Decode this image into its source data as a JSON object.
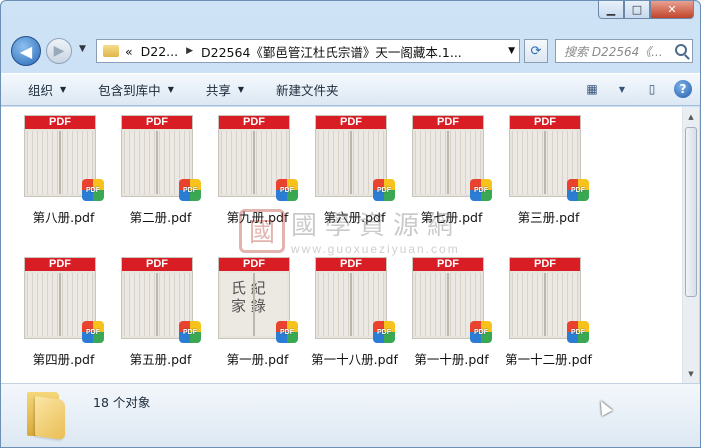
{
  "window": {
    "controls": {
      "minimize": "▁",
      "maximize": "□",
      "close": "✕"
    }
  },
  "nav": {
    "back_icon": "◀",
    "forward_icon": "▶",
    "address_segments": [
      "D22...",
      "D22564《鄞邑管江杜氏宗谱》天一阁藏本.1..."
    ],
    "address_prefix": "«",
    "search_placeholder": "搜索 D22564《...",
    "refresh_icon": "⟳"
  },
  "toolbar": {
    "items": [
      {
        "label": "组织"
      },
      {
        "label": "包含到库中"
      },
      {
        "label": "共享"
      },
      {
        "label": "新建文件夹"
      }
    ],
    "help_label": "?"
  },
  "files": [
    {
      "name": "第八册.pdf",
      "cover": false
    },
    {
      "name": "第二册.pdf",
      "cover": false
    },
    {
      "name": "第九册.pdf",
      "cover": false
    },
    {
      "name": "第六册.pdf",
      "cover": false
    },
    {
      "name": "第七册.pdf",
      "cover": false
    },
    {
      "name": "第三册.pdf",
      "cover": false
    },
    {
      "name": "第四册.pdf",
      "cover": false
    },
    {
      "name": "第五册.pdf",
      "cover": false
    },
    {
      "name": "第一册.pdf",
      "cover": true
    },
    {
      "name": "第一十八册.pdf",
      "cover": false
    },
    {
      "name": "第一十册.pdf",
      "cover": false
    },
    {
      "name": "第一十二册.pdf",
      "cover": false
    }
  ],
  "thumb_band": "PDF",
  "badge_text": "PDF",
  "watermark": {
    "seal": "國",
    "text": "國學資源網",
    "url": "www.guoxueziyuan.com"
  },
  "status": {
    "count": "18 个对象"
  }
}
